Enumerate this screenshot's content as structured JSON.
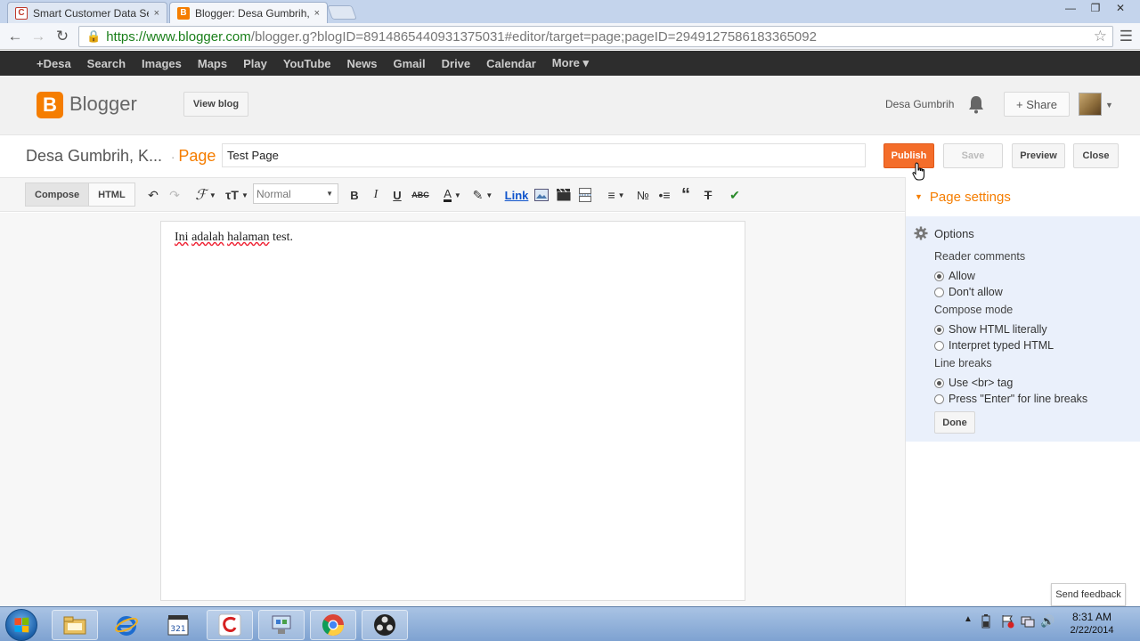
{
  "browser": {
    "tabs": [
      {
        "title": "Smart Customer Data Serv",
        "close": "×",
        "favicon_color": "#c0392b"
      },
      {
        "title": "Blogger: Desa Gumbrih, K",
        "close": "×",
        "favicon_color": "#f57d00"
      }
    ],
    "window_controls": {
      "minimize": "—",
      "restore": "❐",
      "close": "✕"
    },
    "url_scheme": "https://",
    "url_host": "www.blogger.com",
    "url_rest": "/blogger.g?blogID=8914865440931375031#editor/target=page;pageID=2949127586183365092"
  },
  "google_bar": {
    "items": [
      "+Desa",
      "Search",
      "Images",
      "Maps",
      "Play",
      "YouTube",
      "News",
      "Gmail",
      "Drive",
      "Calendar",
      "More ▾"
    ]
  },
  "header": {
    "logo_letter": "B",
    "app_name": "Blogger",
    "view_blog": "View blog",
    "user_name": "Desa Gumbrih",
    "share": "+ Share"
  },
  "title_row": {
    "blog_title": "Desa Gumbrih, K...",
    "separator": "·",
    "type_label": "Page",
    "page_title": "Test Page",
    "publish": "Publish",
    "save": "Save",
    "preview": "Preview",
    "close": "Close"
  },
  "toolbar": {
    "compose": "Compose",
    "html": "HTML",
    "font_format": "Normal",
    "link": "Link"
  },
  "editor": {
    "words": [
      "Ini",
      "adalah",
      "halaman",
      "test."
    ]
  },
  "settings": {
    "heading": "Page settings",
    "options_title": "Options",
    "reader_comments": {
      "label": "Reader comments",
      "options": [
        {
          "label": "Allow",
          "checked": true
        },
        {
          "label": "Don't allow",
          "checked": false
        }
      ]
    },
    "compose_mode": {
      "label": "Compose mode",
      "options": [
        {
          "label": "Show HTML literally",
          "checked": true
        },
        {
          "label": "Interpret typed HTML",
          "checked": false
        }
      ]
    },
    "line_breaks": {
      "label": "Line breaks",
      "options": [
        {
          "label": "Use <br> tag",
          "checked": true
        },
        {
          "label": "Press \"Enter\" for line breaks",
          "checked": false
        }
      ]
    },
    "done": "Done"
  },
  "feedback": "Send feedback",
  "taskbar": {
    "time": "8:31 AM",
    "date": "2/22/2014",
    "tray_arrow": "▲",
    "volume": "🔊"
  },
  "colors": {
    "accent": "#f57d00",
    "publish": "#f46d2a",
    "gbar": "#2d2d2d",
    "panel": "#eaf0fb"
  }
}
